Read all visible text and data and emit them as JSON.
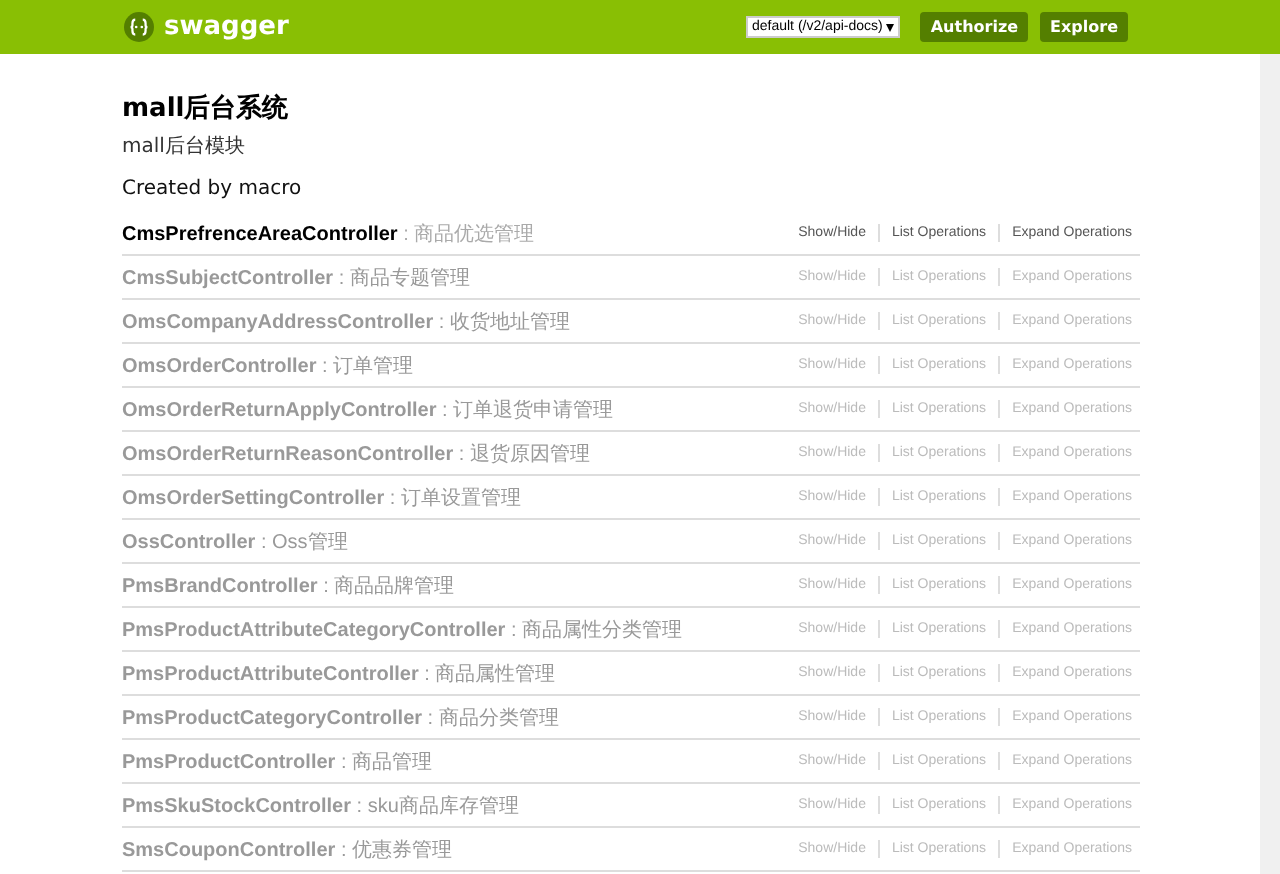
{
  "header": {
    "logo_text": "swagger",
    "api_select": {
      "value": "default (/v2/api-docs)"
    },
    "buttons": [
      "Authorize",
      "Explore"
    ]
  },
  "info": {
    "title": "mall后台系统",
    "description": "mall后台模块",
    "created_by": "Created by macro"
  },
  "resources": [
    {
      "heading": "**CmsPrefrenceAreaController** : 商品优选管理",
      "highlighted": true,
      "operations": [
        "Show/Hide",
        "List Operations",
        "Expand Operations"
      ]
    },
    {
      "heading": "**CmsSubjectController** : 商品专题管理",
      "highlighted": false,
      "operations": [
        "Show/Hide",
        "List Operations",
        "Expand Operations"
      ]
    },
    {
      "heading": "**OmsCompanyAddressController** : 收货地址管理",
      "highlighted": false,
      "operations": [
        "Show/Hide",
        "List Operations",
        "Expand Operations"
      ]
    },
    {
      "heading": "**OmsOrderController** : 订单管理",
      "highlighted": false,
      "operations": [
        "Show/Hide",
        "List Operations",
        "Expand Operations"
      ]
    },
    {
      "heading": "**OmsOrderReturnApplyController** : 订单退货申请管理",
      "highlighted": false,
      "operations": [
        "Show/Hide",
        "List Operations",
        "Expand Operations"
      ]
    },
    {
      "heading": "**OmsOrderReturnReasonController** : 退货原因管理",
      "highlighted": false,
      "operations": [
        "Show/Hide",
        "List Operations",
        "Expand Operations"
      ]
    },
    {
      "heading": "**OmsOrderSettingController** : 订单设置管理",
      "highlighted": false,
      "operations": [
        "Show/Hide",
        "List Operations",
        "Expand Operations"
      ]
    },
    {
      "heading": "**OssController** : Oss管理",
      "highlighted": false,
      "operations": [
        "Show/Hide",
        "List Operations",
        "Expand Operations"
      ]
    },
    {
      "heading": "**PmsBrandController** : 商品品牌管理",
      "highlighted": false,
      "operations": [
        "Show/Hide",
        "List Operations",
        "Expand Operations"
      ]
    },
    {
      "heading": "**PmsProductAttributeCategoryController** : 商品属性分类管理",
      "highlighted": false,
      "operations": [
        "Show/Hide",
        "List Operations",
        "Expand Operations"
      ]
    },
    {
      "heading": "**PmsProductAttributeController** : 商品属性管理",
      "highlighted": false,
      "operations": [
        "Show/Hide",
        "List Operations",
        "Expand Operations"
      ]
    },
    {
      "heading": "**PmsProductCategoryController** : 商品分类管理",
      "highlighted": false,
      "operations": [
        "Show/Hide",
        "List Operations",
        "Expand Operations"
      ]
    },
    {
      "heading": "**PmsProductController** : 商品管理",
      "highlighted": false,
      "operations": [
        "Show/Hide",
        "List Operations",
        "Expand Operations"
      ]
    },
    {
      "heading": "**PmsSkuStockController** : sku商品库存管理",
      "highlighted": false,
      "operations": [
        "Show/Hide",
        "List Operations",
        "Expand Operations"
      ]
    },
    {
      "heading": "**SmsCouponController** : 优惠券管理",
      "highlighted": false,
      "operations": [
        "Show/Hide",
        "List Operations",
        "Expand Operations"
      ]
    }
  ]
}
